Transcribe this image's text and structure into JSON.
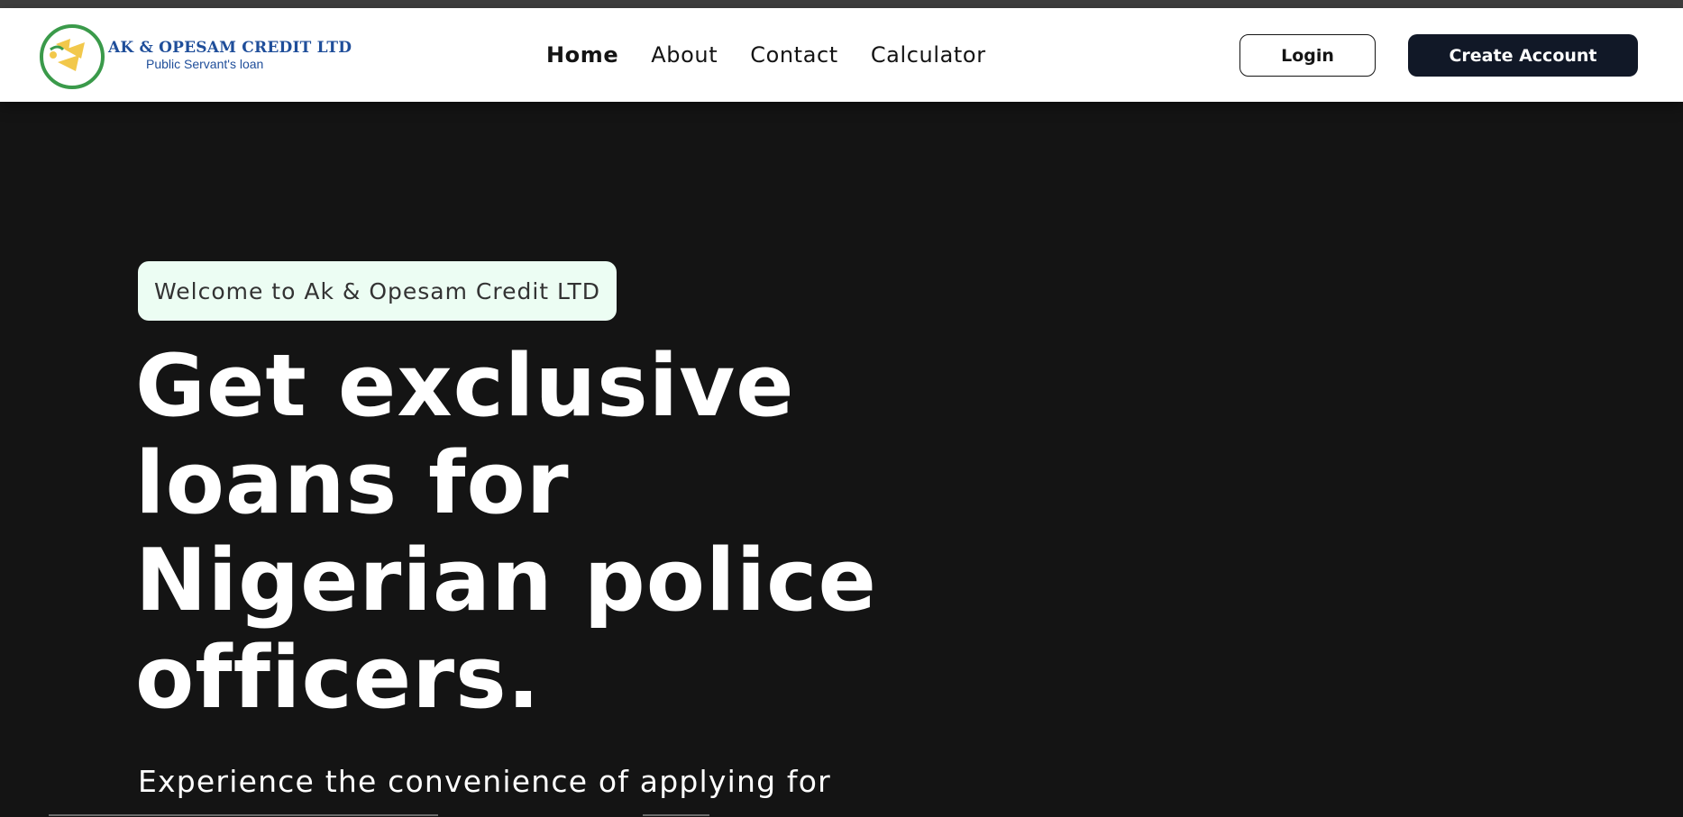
{
  "brand": {
    "name": "AK & OPESAM CREDIT LTD",
    "tagline": "Public Servant's loan",
    "logo_icon": "logo-emblem-icon",
    "colors": {
      "ring": "#3a9a4a",
      "gold": "#f2c84b",
      "blue": "#1f4e9a"
    }
  },
  "nav": {
    "links": [
      {
        "label": "Home",
        "active": true
      },
      {
        "label": "About",
        "active": false
      },
      {
        "label": "Contact",
        "active": false
      },
      {
        "label": "Calculator",
        "active": false
      }
    ],
    "login_label": "Login",
    "create_account_label": "Create Account"
  },
  "hero": {
    "badge": "Welcome to Ak & Opesam Credit LTD",
    "title": "Get exclusive loans for Nigerian police officers.",
    "subtitle": "Experience the convenience of applying for"
  },
  "colors": {
    "hero_background": "#141414",
    "badge_background": "#ecfdf3",
    "primary_button": "#111827"
  }
}
